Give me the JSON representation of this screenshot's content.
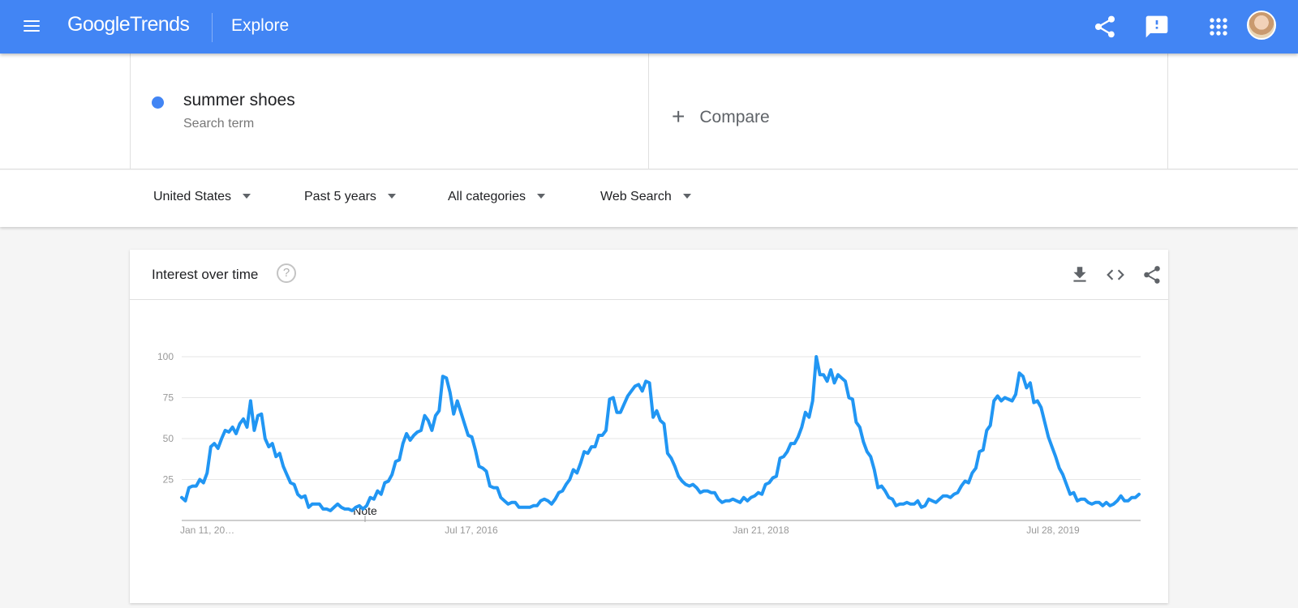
{
  "header": {
    "logo_google": "Google",
    "logo_trends": "Trends",
    "section": "Explore",
    "icons": [
      "menu-icon",
      "share-icon",
      "feedback-icon",
      "apps-icon",
      "avatar"
    ],
    "bar_color": "#4285f4"
  },
  "search": {
    "term": "summer shoes",
    "term_type": "Search term",
    "term_color": "#4285f4",
    "compare_plus": "+",
    "compare_label": "Compare"
  },
  "filters": {
    "region": "United States",
    "time": "Past 5 years",
    "category": "All categories",
    "property": "Web Search"
  },
  "card": {
    "title": "Interest over time",
    "help": "?",
    "actions": [
      "download-icon",
      "embed-icon",
      "share-icon"
    ]
  },
  "chart_data": {
    "type": "line",
    "title": "",
    "xlabel": "",
    "ylabel": "",
    "ylim": [
      0,
      100
    ],
    "y_ticks": [
      25,
      50,
      75,
      100
    ],
    "x_tick_labels": [
      "Jan 11, 20…",
      "Jul 17, 2016",
      "Jan 21, 2018",
      "Jul 28, 2019"
    ],
    "note_label": "Note",
    "grid": true,
    "legend": "none",
    "series_color": "#2196f3",
    "series": [
      {
        "values": [
          14,
          12,
          20,
          21,
          21,
          25,
          23,
          29,
          45,
          47,
          44,
          50,
          55,
          54,
          57,
          53,
          59,
          62,
          57,
          73,
          55,
          64,
          65,
          50,
          45,
          47,
          39,
          41,
          33,
          28,
          23,
          22,
          16,
          14,
          15,
          8,
          10,
          10,
          10,
          7,
          7,
          6,
          8,
          10,
          8,
          7,
          7,
          6,
          8,
          9,
          7,
          9,
          14,
          13,
          18,
          16,
          23,
          24,
          28,
          36,
          37,
          47,
          53,
          49,
          52,
          54,
          55,
          64,
          61,
          55,
          64,
          67,
          88,
          87,
          78,
          65,
          73,
          66,
          59,
          52,
          51,
          43,
          33,
          32,
          30,
          21,
          20,
          20,
          14,
          12,
          10,
          11,
          11,
          8,
          8,
          8,
          8,
          9,
          9,
          12,
          13,
          12,
          10,
          13,
          17,
          18,
          22,
          25,
          31,
          29,
          35,
          42,
          41,
          45,
          45,
          52,
          52,
          55,
          74,
          75,
          66,
          66,
          71,
          76,
          79,
          82,
          83,
          79,
          85,
          84,
          63,
          67,
          61,
          59,
          41,
          38,
          33,
          27,
          24,
          22,
          21,
          22,
          20,
          17,
          18,
          18,
          17,
          17,
          13,
          11,
          12,
          12,
          13,
          12,
          11,
          14,
          12,
          14,
          15,
          17,
          16,
          22,
          23,
          26,
          27,
          38,
          39,
          42,
          47,
          47,
          51,
          57,
          66,
          63,
          73,
          100,
          89,
          89,
          85,
          92,
          84,
          89,
          87,
          85,
          75,
          74,
          60,
          57,
          48,
          42,
          39,
          31,
          20,
          21,
          18,
          14,
          13,
          9,
          10,
          10,
          11,
          10,
          10,
          12,
          8,
          9,
          13,
          12,
          11,
          13,
          15,
          15,
          14,
          16,
          17,
          21,
          24,
          23,
          29,
          32,
          42,
          43,
          55,
          58,
          73,
          76,
          73,
          75,
          74,
          73,
          77,
          90,
          88,
          81,
          84,
          72,
          73,
          69,
          60,
          51,
          45,
          39,
          32,
          28,
          22,
          16,
          17,
          12,
          13,
          13,
          11,
          10,
          11,
          11,
          9,
          11,
          9,
          10,
          12,
          15,
          12,
          12,
          14,
          14,
          16
        ]
      }
    ]
  }
}
